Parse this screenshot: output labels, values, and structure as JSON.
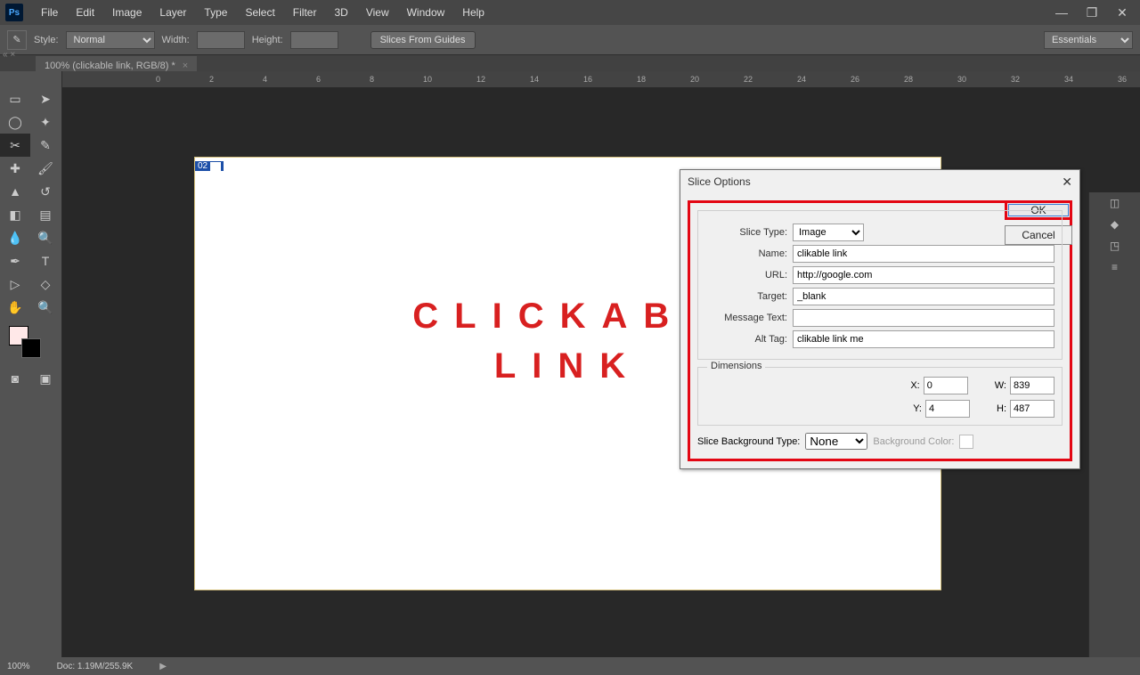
{
  "menu": [
    "File",
    "Edit",
    "Image",
    "Layer",
    "Type",
    "Select",
    "Filter",
    "3D",
    "View",
    "Window",
    "Help"
  ],
  "optbar": {
    "style_label": "Style:",
    "style_value": "Normal",
    "width_label": "Width:",
    "height_label": "Height:",
    "slices_btn": "Slices From Guides"
  },
  "workspace": "Essentials",
  "tab": "100% (clickable link, RGB/8) *",
  "doc_text_line1": "CLICKABL",
  "doc_text_line2": "LINK",
  "slice_num": "02",
  "dialog": {
    "title": "Slice Options",
    "slice_type_label": "Slice Type:",
    "slice_type_value": "Image",
    "name_label": "Name:",
    "name_value": "clikable link",
    "url_label": "URL:",
    "url_value": "http://google.com",
    "target_label": "Target:",
    "target_value": "_blank",
    "msg_label": "Message Text:",
    "msg_value": "",
    "alt_label": "Alt Tag:",
    "alt_value": "clikable link me",
    "dim_legend": "Dimensions",
    "x_label": "X:",
    "x_value": "0",
    "y_label": "Y:",
    "y_value": "4",
    "w_label": "W:",
    "w_value": "839",
    "h_label": "H:",
    "h_value": "487",
    "bgtype_label": "Slice Background Type:",
    "bgtype_value": "None",
    "bgcolor_label": "Background Color:",
    "ok": "OK",
    "cancel": "Cancel"
  },
  "ruler": [
    "0",
    "2",
    "4",
    "6",
    "8",
    "10",
    "12",
    "14",
    "16",
    "18",
    "20",
    "22",
    "24",
    "26",
    "28",
    "30",
    "32",
    "34",
    "36"
  ],
  "status": {
    "zoom": "100%",
    "doc": "Doc: 1.19M/255.9K"
  }
}
